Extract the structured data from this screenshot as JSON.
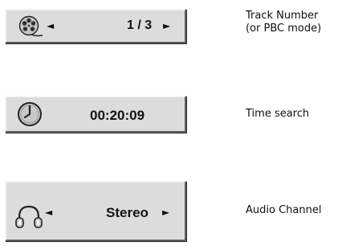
{
  "track_panel": {
    "left_arrow": "◄",
    "value": "1 / 3",
    "right_arrow": "►",
    "caption_line1": "Track Number",
    "caption_line2": "(or PBC mode)",
    "icon": "film-reel-icon"
  },
  "time_panel": {
    "value": "00:20:09",
    "caption": "Time search",
    "icon": "clock-icon"
  },
  "audio_panel": {
    "left_arrow": "◄",
    "value": "Stereo",
    "right_arrow": "►",
    "caption": "Audio Channel",
    "icon": "headphones-icon"
  },
  "colors": {
    "panel_bg": "#dcdcdc",
    "panel_highlight": "#f4f4f4",
    "panel_shadow": "#5e5e5e",
    "text": "#111111"
  }
}
